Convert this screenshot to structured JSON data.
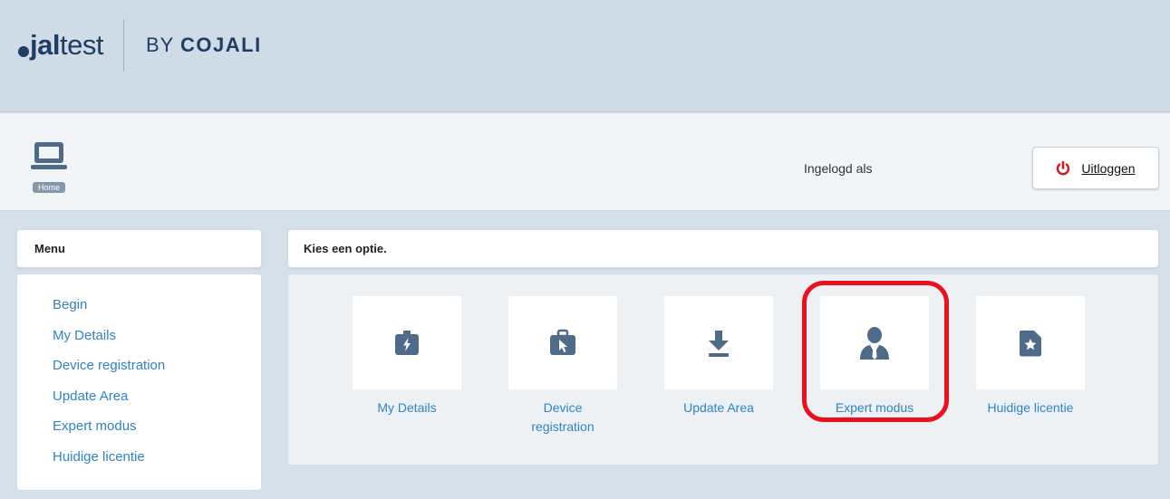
{
  "brand": {
    "dot": "●",
    "name_bold": "jal",
    "name_light": "test",
    "by": "BY",
    "company": "COJALI"
  },
  "header": {
    "home_label": "Home",
    "logged_in_label": "Ingelogd als",
    "logout_label": "Uitloggen"
  },
  "menu": {
    "title": "Menu",
    "items": [
      "Begin",
      "My Details",
      "Device registration",
      "Update Area",
      "Expert modus",
      "Huidige licentie"
    ]
  },
  "main": {
    "title": "Kies een optie.",
    "tiles": [
      {
        "label": "My Details",
        "icon": "id-card-bolt-icon"
      },
      {
        "label": "Device registration",
        "icon": "briefcase-cursor-icon"
      },
      {
        "label": "Update Area",
        "icon": "download-icon"
      },
      {
        "label": "Expert modus",
        "icon": "expert-user-icon"
      },
      {
        "label": "Huidige licentie",
        "icon": "license-star-icon"
      }
    ]
  },
  "colors": {
    "brand_navy": "#1f3e63",
    "link_blue": "#2f83c5",
    "icon_slate": "#4f6b8a",
    "highlight_red": "#e8111d",
    "power_red": "#cc1c1c"
  }
}
